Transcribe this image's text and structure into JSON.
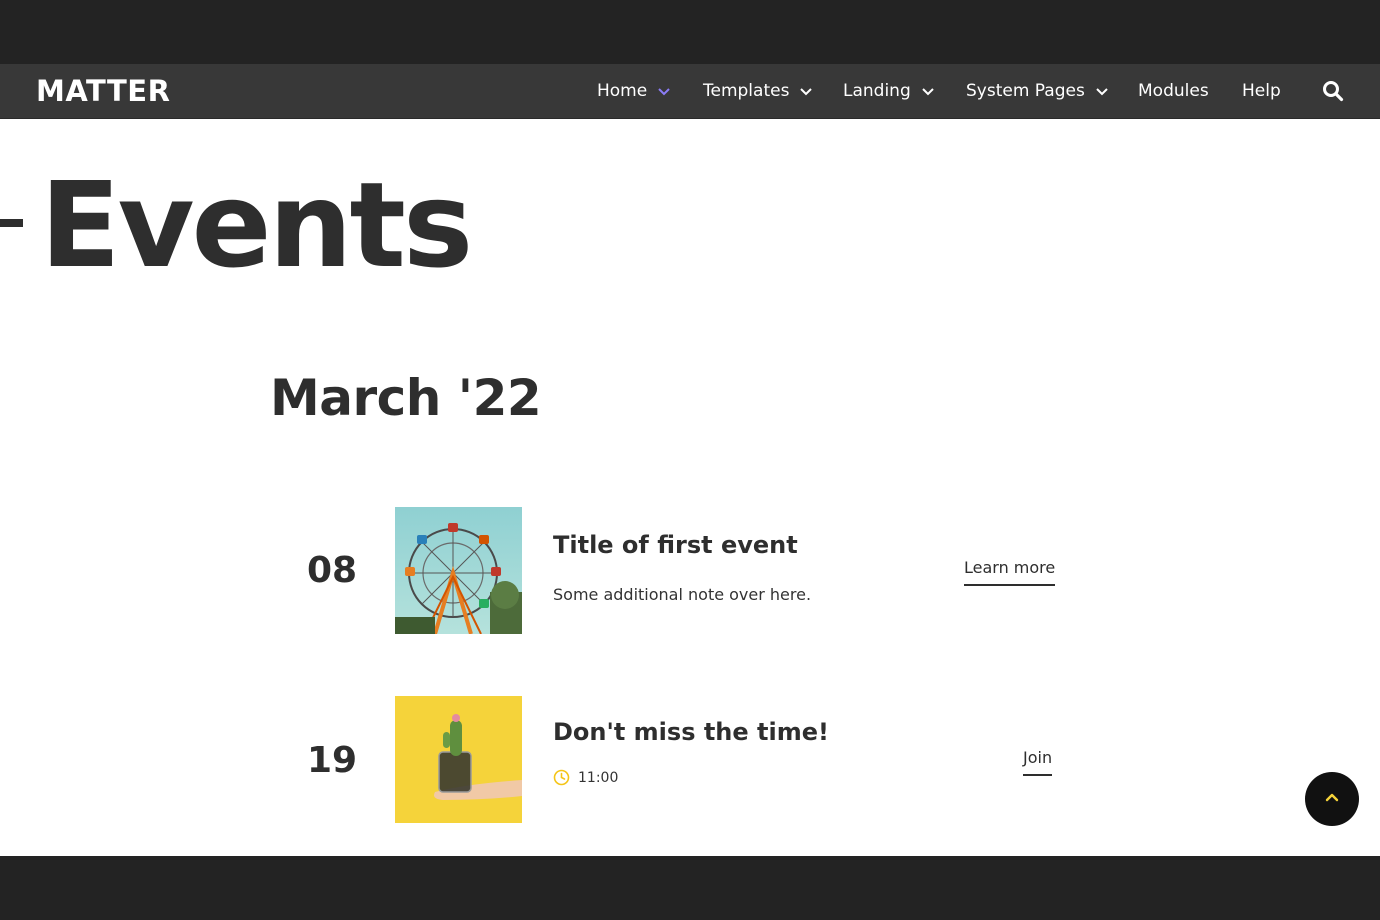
{
  "brand": {
    "logo": "MATTER"
  },
  "nav": {
    "items": [
      {
        "label": "Home",
        "has_dropdown": true,
        "chevron_color": "#8b7cf6"
      },
      {
        "label": "Templates",
        "has_dropdown": true,
        "chevron_color": "#ffffff"
      },
      {
        "label": "Landing",
        "has_dropdown": true,
        "chevron_color": "#ffffff"
      },
      {
        "label": "System Pages",
        "has_dropdown": true,
        "chevron_color": "#ffffff"
      },
      {
        "label": "Modules",
        "has_dropdown": false
      },
      {
        "label": "Help",
        "has_dropdown": false
      }
    ],
    "search_icon": "search-icon"
  },
  "page": {
    "title": "Events",
    "month": "March '22"
  },
  "events": [
    {
      "day": "08",
      "image": "ferris-wheel-photo",
      "title": "Title of first event",
      "note": "Some additional note over here.",
      "link": "Learn more"
    },
    {
      "day": "19",
      "image": "cactus-in-hand-photo",
      "title": "Don't miss the time!",
      "time": "11:00",
      "link": "Join"
    }
  ],
  "colors": {
    "topbar": "#232323",
    "navbar": "#383838",
    "text": "#2e2e2e",
    "accent_purple": "#8b7cf6",
    "accent_yellow": "#f5d33a"
  },
  "scroll_top_icon": "chevron-up-icon"
}
